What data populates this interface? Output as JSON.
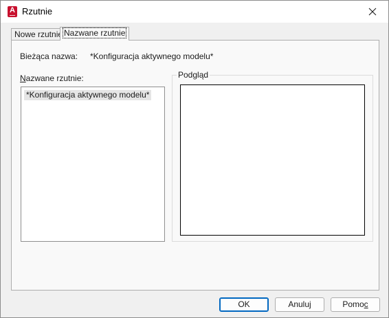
{
  "window": {
    "title": "Rzutnie"
  },
  "tabs": [
    {
      "label": "Nowe rzutnie"
    },
    {
      "label": "Nazwane rzutnie"
    }
  ],
  "current": {
    "label": "Bieżąca nazwa:",
    "value": "*Konfiguracja aktywnego modelu*"
  },
  "named_list": {
    "label_first": "N",
    "label_rest": "azwane rzutnie:",
    "items": [
      "*Konfiguracja aktywnego modelu*"
    ]
  },
  "preview": {
    "label": "Podgląd"
  },
  "buttons": {
    "ok": "OK",
    "cancel": "Anuluj",
    "help_main": "Pomo",
    "help_accel": "c"
  },
  "colors": {
    "accent": "#0067c0",
    "app_icon": "#c8102e"
  }
}
